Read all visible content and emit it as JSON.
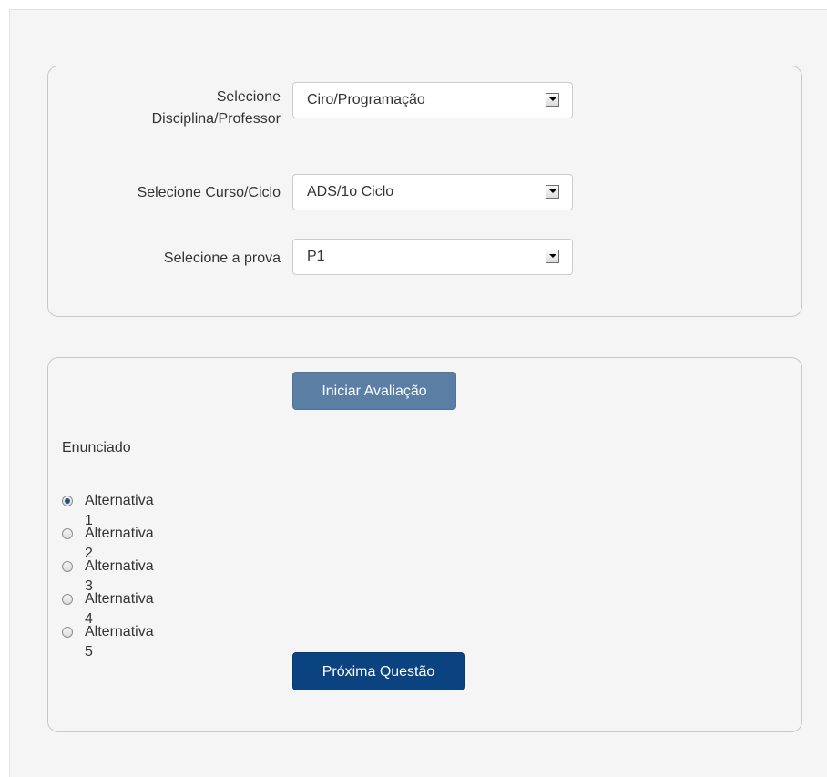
{
  "form": {
    "discipline": {
      "label_line1": "Selecione",
      "label_line2": "Disciplina/Professor",
      "value": "Ciro/Programação"
    },
    "course": {
      "label": "Selecione Curso/Ciclo",
      "value": "ADS/1o Ciclo"
    },
    "exam": {
      "label": "Selecione a prova",
      "value": "P1"
    }
  },
  "quiz": {
    "start_label": "Iniciar Avaliação",
    "statement": "Enunciado",
    "alternatives": [
      {
        "label": "Alternativa 1",
        "checked": true
      },
      {
        "label": "Alternativa 2",
        "checked": false
      },
      {
        "label": "Alternativa 3",
        "checked": false
      },
      {
        "label": "Alternativa 4",
        "checked": false
      },
      {
        "label": "Alternativa 5",
        "checked": false
      }
    ],
    "next_label": "Próxima Questão"
  },
  "colors": {
    "start_button": "#5b7fa4",
    "next_button": "#0a4380",
    "panel_background": "#f5f5f5"
  }
}
